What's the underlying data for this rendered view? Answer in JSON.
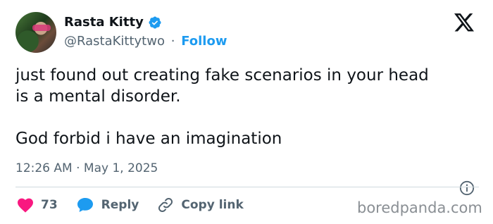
{
  "author": {
    "name": "Rasta Kitty",
    "handle": "@RastaKittytwo",
    "separator": "·",
    "follow_label": "Follow"
  },
  "tweet": {
    "text": "just found out creating fake scenarios in your head\nis a mental disorder.\n\nGod forbid i have an imagination",
    "timestamp": "12:26 AM · May 1, 2025"
  },
  "actions": {
    "likes_count": "73",
    "reply_label": "Reply",
    "copy_link_label": "Copy link"
  },
  "watermark": "boredpanda.com",
  "colors": {
    "accent": "#1d9bf0",
    "like": "#f91880",
    "text": "#0f1419",
    "muted": "#536471"
  },
  "icons": {
    "verified": "verified-badge-icon",
    "x_logo": "x-logo-icon",
    "info": "info-icon",
    "like": "heart-icon",
    "reply": "speech-bubble-icon",
    "copy_link": "link-icon"
  }
}
